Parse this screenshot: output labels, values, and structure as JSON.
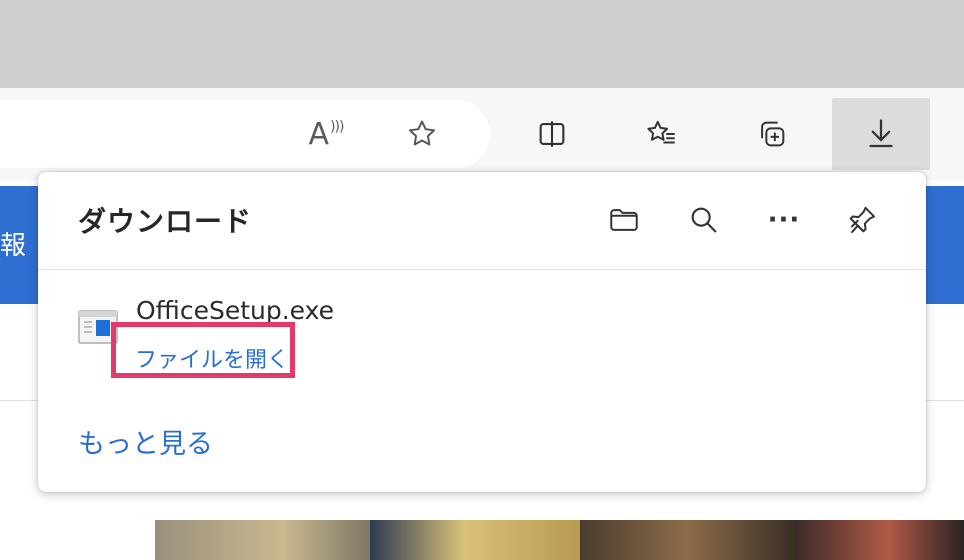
{
  "toolbar": {
    "read_aloud_glyph": "A",
    "icons": [
      "read-aloud-icon",
      "favorite-star-icon",
      "split-screen-icon",
      "favorites-list-icon",
      "collections-icon",
      "download-icon"
    ]
  },
  "page": {
    "partial_text": "報"
  },
  "downloads_panel": {
    "title": "ダウンロード",
    "header_icons": [
      "folder-icon",
      "search-icon",
      "more-icon",
      "pin-icon"
    ],
    "more_glyph": "···",
    "item": {
      "file_name": "OfficeSetup.exe",
      "action_label": "ファイルを開く"
    },
    "see_more_label": "もっと見る"
  },
  "colors": {
    "accent_link": "#2a6fcf",
    "highlight": "#e23b6a",
    "blue_band": "#2f6fd1",
    "tabstrip": "#cfcfcf"
  }
}
